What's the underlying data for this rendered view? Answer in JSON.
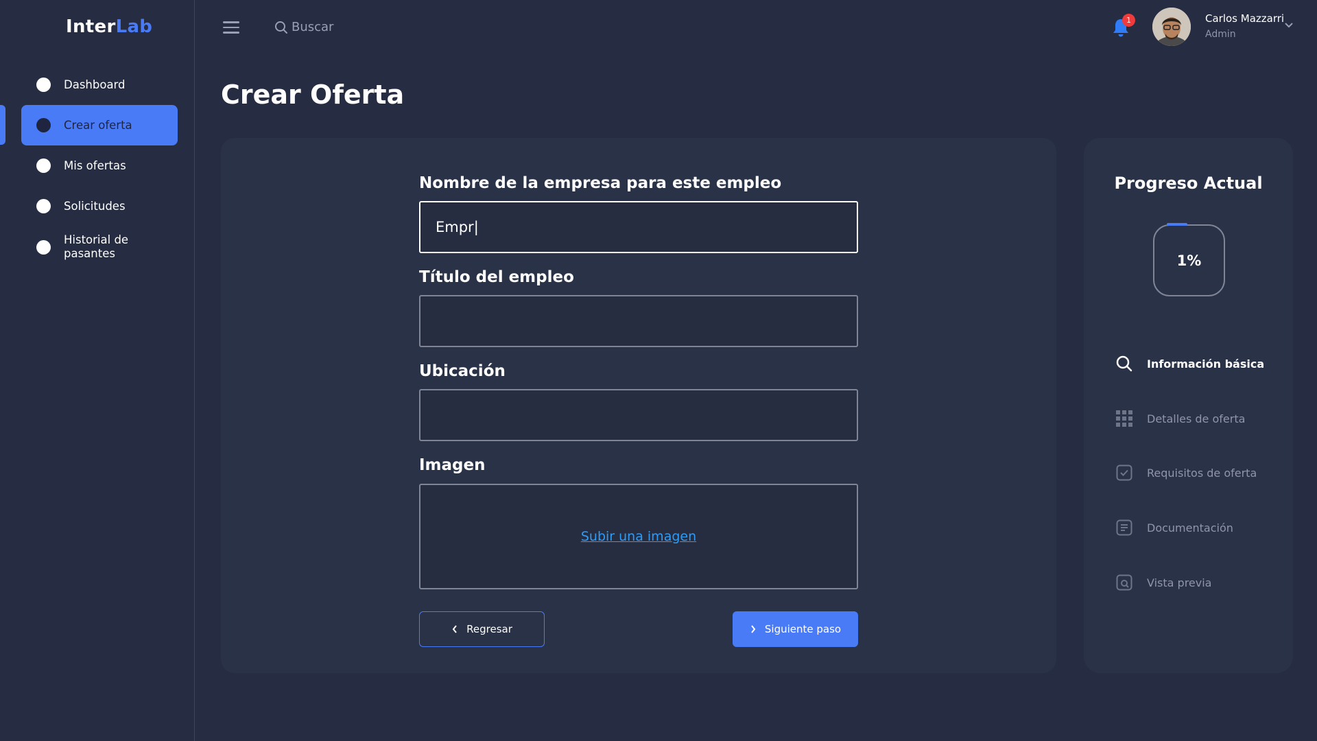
{
  "brand": {
    "part1": "Inter",
    "part2": "Lab"
  },
  "sidebar": {
    "items": [
      {
        "label": "Dashboard"
      },
      {
        "label": "Crear oferta"
      },
      {
        "label": "Mis ofertas"
      },
      {
        "label": "Solicitudes"
      },
      {
        "label": "Historial de pasantes"
      }
    ],
    "active_index": 1
  },
  "header": {
    "search_placeholder": "Buscar",
    "notifications_count": "1",
    "user_name": "Carlos Mazzarri",
    "user_role": "Admin"
  },
  "page": {
    "title": "Crear Oferta"
  },
  "form": {
    "company_label": "Nombre de la empresa para este empleo",
    "company_value": "Empr|",
    "title_label": "Título del empleo",
    "title_value": "",
    "location_label": "Ubicación",
    "location_value": "",
    "image_label": "Imagen",
    "upload_link": "Subir una imagen",
    "back_button": "Regresar",
    "next_button": "Siguiente paso"
  },
  "progress": {
    "title": "Progreso Actual",
    "percent": "1%",
    "value": 0.01,
    "steps": [
      {
        "label": "Información básica",
        "icon": "search-icon",
        "current": true
      },
      {
        "label": "Detalles de oferta",
        "icon": "grid-icon",
        "current": false
      },
      {
        "label": "Requisitos de oferta",
        "icon": "checkbox-icon",
        "current": false
      },
      {
        "label": "Documentación",
        "icon": "document-icon",
        "current": false
      },
      {
        "label": "Vista previa",
        "icon": "preview-icon",
        "current": false
      }
    ]
  },
  "colors": {
    "background": "#262c41",
    "card": "#2a3247",
    "accent": "#4a7bf7",
    "link": "#2f9bf5",
    "badge": "#ef3b3b"
  }
}
